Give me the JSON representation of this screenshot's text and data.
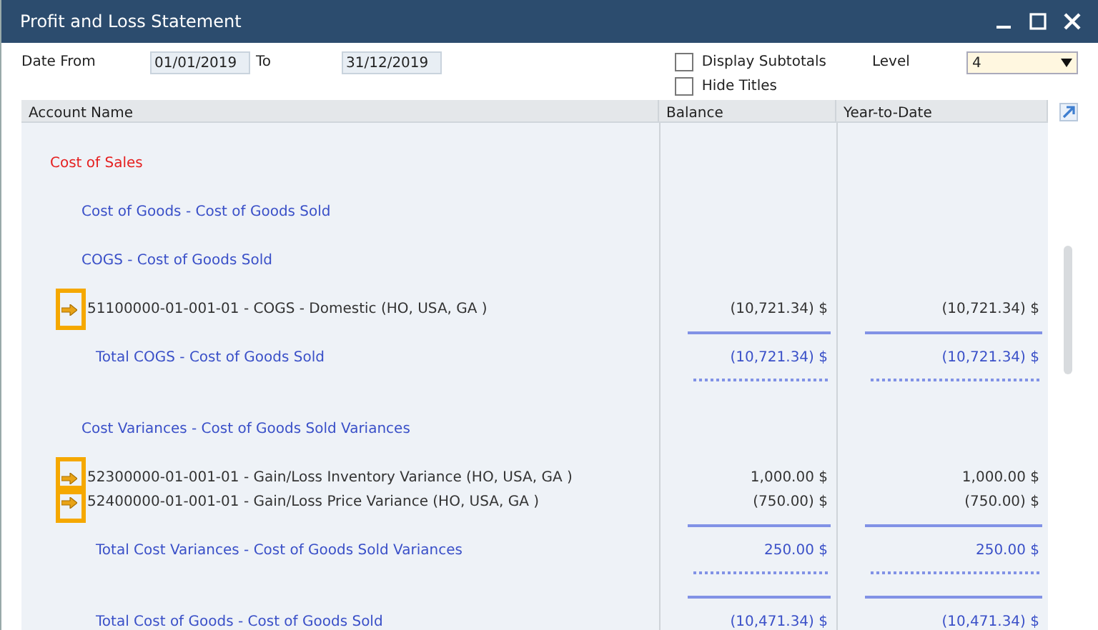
{
  "window": {
    "title": "Profit and Loss Statement"
  },
  "filters": {
    "date_from_label": "Date From",
    "date_from": "01/01/2019",
    "to_label": "To",
    "date_to": "31/12/2019",
    "options": [
      {
        "label": "Display Subtotals",
        "checked": false
      },
      {
        "label": "Hide Titles",
        "checked": false
      }
    ],
    "level_label": "Level",
    "level": "4"
  },
  "table": {
    "columns": [
      "Account Name",
      "Balance",
      "Year-to-Date"
    ],
    "rows": [
      {
        "kind": "title",
        "name": "Cost of Sales"
      },
      {
        "kind": "group",
        "name": "Cost of Goods - Cost of Goods Sold"
      },
      {
        "kind": "group",
        "name": "COGS - Cost of Goods Sold"
      },
      {
        "kind": "account",
        "name": "51100000-01-001-01 - COGS - Domestic (HO, USA, GA )",
        "balance": "(10,721.34) $",
        "ytd": "(10,721.34) $",
        "highlighted": true
      },
      {
        "kind": "total",
        "name": "Total COGS - Cost of Goods Sold",
        "balance": "(10,721.34) $",
        "ytd": "(10,721.34) $"
      },
      {
        "kind": "group",
        "name": "Cost Variances - Cost of Goods Sold Variances"
      },
      {
        "kind": "account",
        "name": "52300000-01-001-01 - Gain/Loss Inventory Variance (HO, USA, GA )",
        "balance": "1,000.00 $",
        "ytd": "1,000.00 $",
        "highlighted": true
      },
      {
        "kind": "account",
        "name": "52400000-01-001-01 - Gain/Loss Price Variance (HO, USA, GA )",
        "balance": "(750.00) $",
        "ytd": "(750.00) $",
        "highlighted": true
      },
      {
        "kind": "total",
        "name": "Total Cost Variances - Cost of Goods Sold Variances",
        "balance": "250.00 $",
        "ytd": "250.00 $"
      },
      {
        "kind": "total",
        "name": "Total Cost of Goods - Cost of Goods Sold",
        "balance": "(10,471.34) $",
        "ytd": "(10,471.34) $"
      }
    ]
  }
}
